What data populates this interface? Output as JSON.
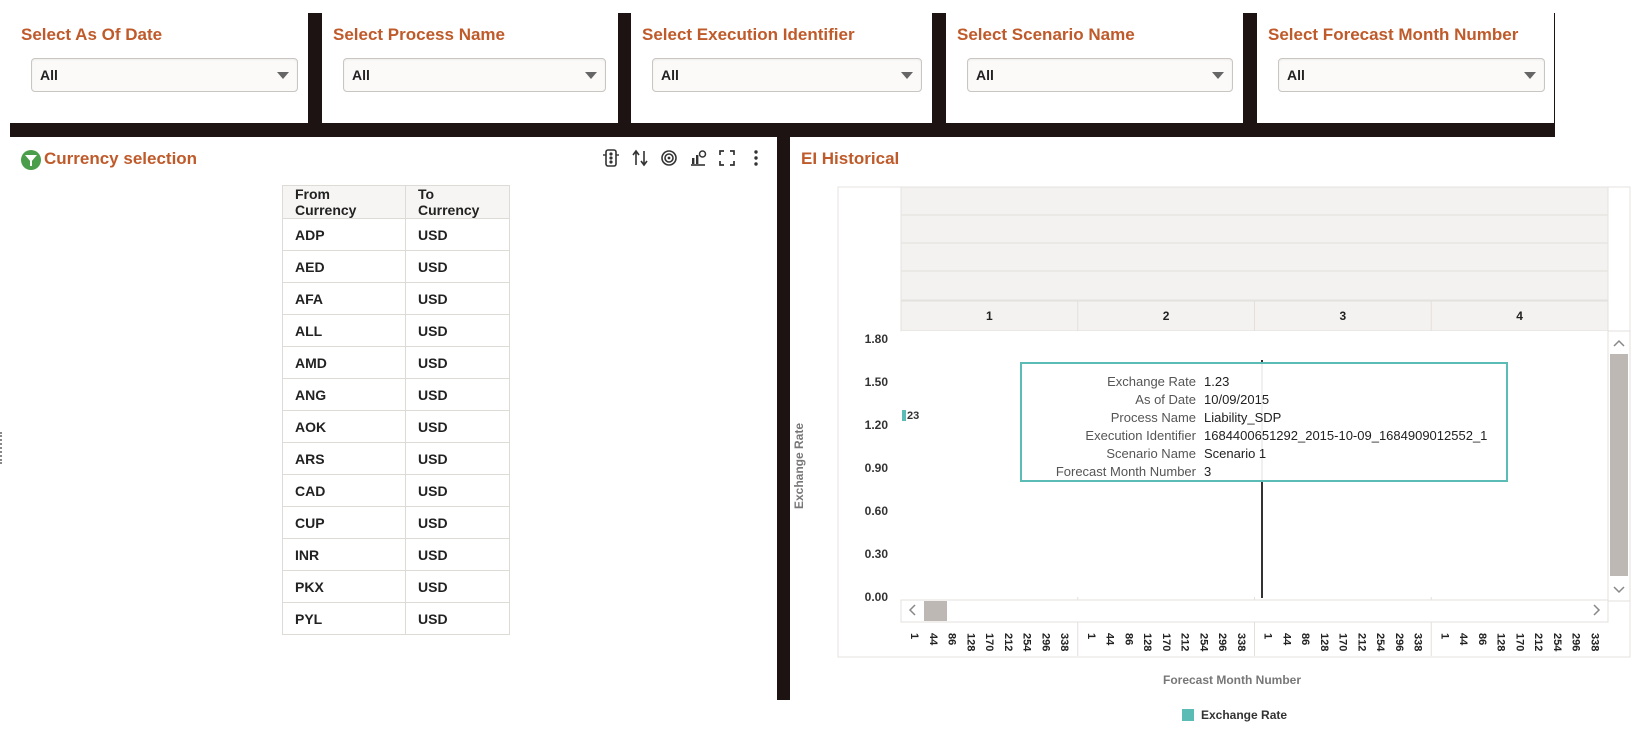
{
  "filters": [
    {
      "title": "Select As Of Date",
      "value": "All"
    },
    {
      "title": "Select Process Name",
      "value": "All"
    },
    {
      "title": "Select Execution Identifier",
      "value": "All"
    },
    {
      "title": "Select Scenario Name",
      "value": "All"
    },
    {
      "title": "Select Forecast Month Number",
      "value": "All"
    }
  ],
  "currency_panel": {
    "title": "Currency selection",
    "toolbar_icons": [
      "traffic-light-icon",
      "sort-icon",
      "target-icon",
      "chart-settings-icon",
      "fullscreen-icon",
      "more-options-icon"
    ],
    "table": {
      "headers": [
        "From Currency",
        "To Currency"
      ],
      "rows": [
        [
          "ADP",
          "USD"
        ],
        [
          "AED",
          "USD"
        ],
        [
          "AFA",
          "USD"
        ],
        [
          "ALL",
          "USD"
        ],
        [
          "AMD",
          "USD"
        ],
        [
          "ANG",
          "USD"
        ],
        [
          "AOK",
          "USD"
        ],
        [
          "ARS",
          "USD"
        ],
        [
          "CAD",
          "USD"
        ],
        [
          "CUP",
          "USD"
        ],
        [
          "INR",
          "USD"
        ],
        [
          "PKX",
          "USD"
        ],
        [
          "PYL",
          "USD"
        ]
      ]
    }
  },
  "chart_panel": {
    "title": "EI Historical"
  },
  "chart_data": {
    "type": "bar",
    "title": "EI Historical",
    "xlabel": "Forecast Month Number",
    "ylabel": "Exchange Rate",
    "ylim": [
      0,
      1.8
    ],
    "y_ticks": [
      "1.80",
      "1.50",
      "1.20",
      "0.90",
      "0.60",
      "0.30",
      "0.00"
    ],
    "facets": [
      "1",
      "2",
      "3",
      "4"
    ],
    "x_ticks": [
      "1",
      "44",
      "86",
      "128",
      "170",
      "212",
      "254",
      "296",
      "338"
    ],
    "series": [
      {
        "name": "Exchange Rate",
        "color": "#5bbcb6"
      }
    ],
    "data_label": "23",
    "legend": "bottom"
  },
  "tooltip": [
    {
      "key": "Exchange Rate",
      "value": "1.23"
    },
    {
      "key": "As of Date",
      "value": "10/09/2015"
    },
    {
      "key": "Process Name",
      "value": "Liability_SDP"
    },
    {
      "key": "Execution Identifier",
      "value": "1684400651292_2015-10-09_1684909012552_1"
    },
    {
      "key": "Scenario Name",
      "value": "Scenario 1"
    },
    {
      "key": "Forecast Month Number",
      "value": "3"
    }
  ],
  "colors": {
    "accent": "#bf5a2a",
    "divider": "#1c1312",
    "series": "#5bbcb6",
    "filter_icon": "#4a9d4a"
  }
}
